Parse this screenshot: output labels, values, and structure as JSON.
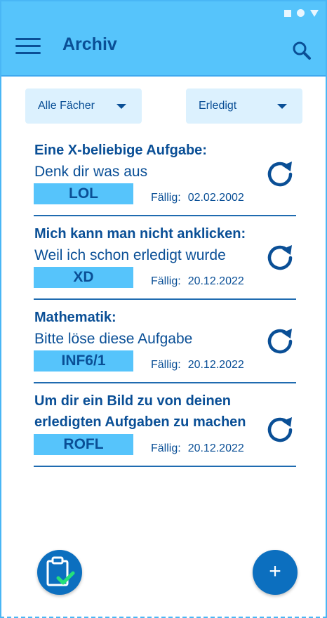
{
  "app": {
    "title": "Archiv"
  },
  "filters": {
    "subject": "Alle Fächer",
    "status": "Erledigt"
  },
  "tasks": [
    {
      "title": "Eine X-beliebige Aufgabe:",
      "description": "Denk dir was aus",
      "subject": "LOL",
      "due_label": "Fällig:",
      "due_date": "02.02.2002"
    },
    {
      "title": "Mich kann man nicht anklicken:",
      "description": "Weil ich schon erledigt wurde",
      "subject": "XD",
      "due_label": "Fällig:",
      "due_date": "20.12.2022"
    },
    {
      "title": "Mathematik:",
      "description": "Bitte löse diese Aufgabe",
      "subject": "INF6/1",
      "due_label": "Fällig:",
      "due_date": "20.12.2022"
    },
    {
      "title": "Um dir ein Bild zu von deinen",
      "description": "erledigten Aufgaben zu machen",
      "subject": "ROFL",
      "due_label": "Fällig:",
      "due_date": "20.12.2022"
    }
  ],
  "fab": {
    "add_label": "+"
  },
  "icons": {
    "menu": "menu-icon",
    "search": "search-icon",
    "refresh": "refresh-icon",
    "clipboard": "clipboard-check-icon",
    "add": "plus-icon"
  },
  "colors": {
    "primary": "#56c4fb",
    "dark": "#0a4f96",
    "accent": "#0c6fbf",
    "check": "#25e07a",
    "filter_bg": "#dcf1fe"
  }
}
